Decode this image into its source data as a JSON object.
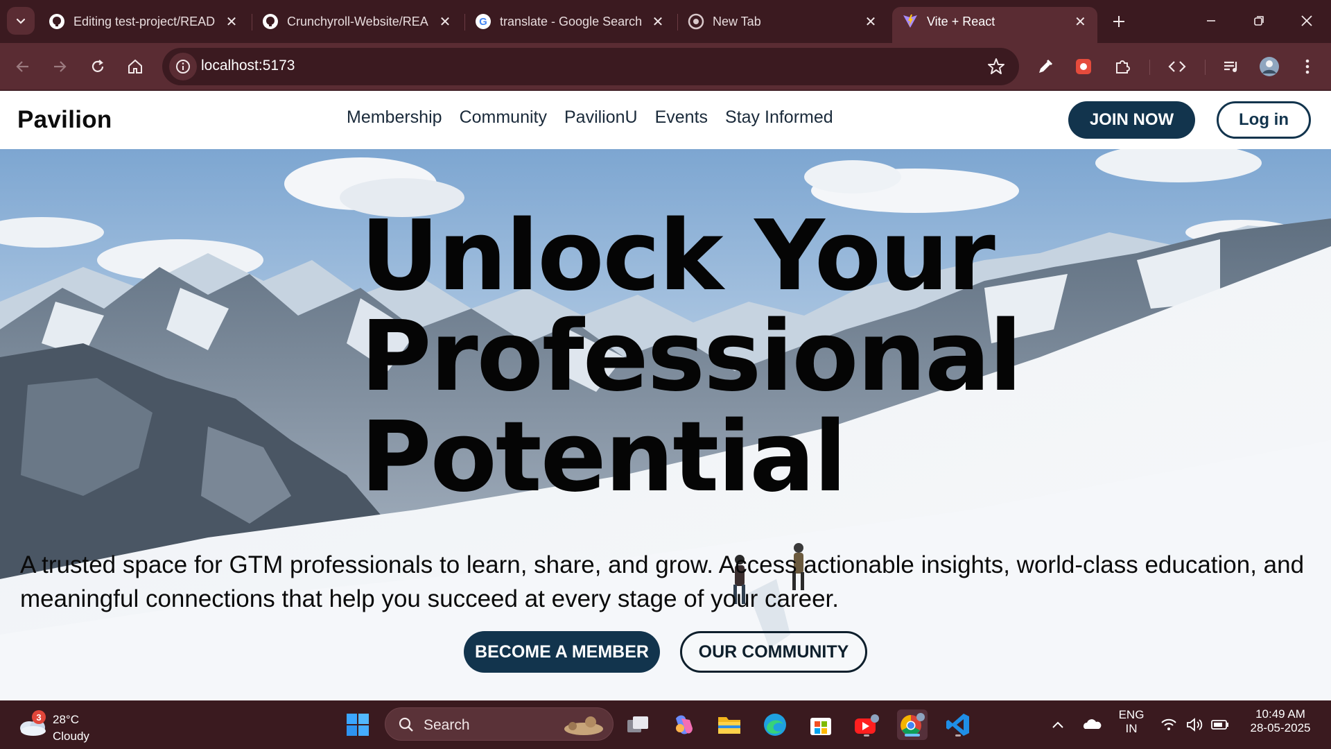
{
  "browser": {
    "tabs": [
      {
        "title": "Editing test-project/README",
        "icon": "github-icon",
        "active": false
      },
      {
        "title": "Crunchyroll-Website/README",
        "icon": "github-icon",
        "active": false
      },
      {
        "title": "translate - Google Search",
        "icon": "google-icon",
        "active": false
      },
      {
        "title": "New Tab",
        "icon": "chrome-icon",
        "active": false
      },
      {
        "title": "Vite + React",
        "icon": "vite-icon",
        "active": true
      }
    ],
    "url": "localhost:5173"
  },
  "site": {
    "brand": "Pavilion",
    "nav": [
      "Membership",
      "Community",
      "PavilionU",
      "Events",
      "Stay Informed"
    ],
    "join_label": "JOIN NOW",
    "login_label": "Log in",
    "headline": [
      "Unlock Your",
      "Professional",
      "Potential"
    ],
    "subtext": "A trusted space for GTM professionals to learn, share, and grow. Access actionable insights, world-class education, and meaningful connections that help you succeed at every stage of your career.",
    "cta_primary": "BECOME A MEMBER",
    "cta_secondary": "OUR COMMUNITY",
    "colors": {
      "primary": "#12344d",
      "chrome": "#5a2c33",
      "tabstrip": "#3b1a20"
    }
  },
  "taskbar": {
    "weather": {
      "temp": "28°C",
      "condition": "Cloudy",
      "badge": "3"
    },
    "search_label": "Search",
    "language": {
      "line1": "ENG",
      "line2": "IN"
    },
    "time": "10:49 AM",
    "date": "28-05-2025"
  }
}
